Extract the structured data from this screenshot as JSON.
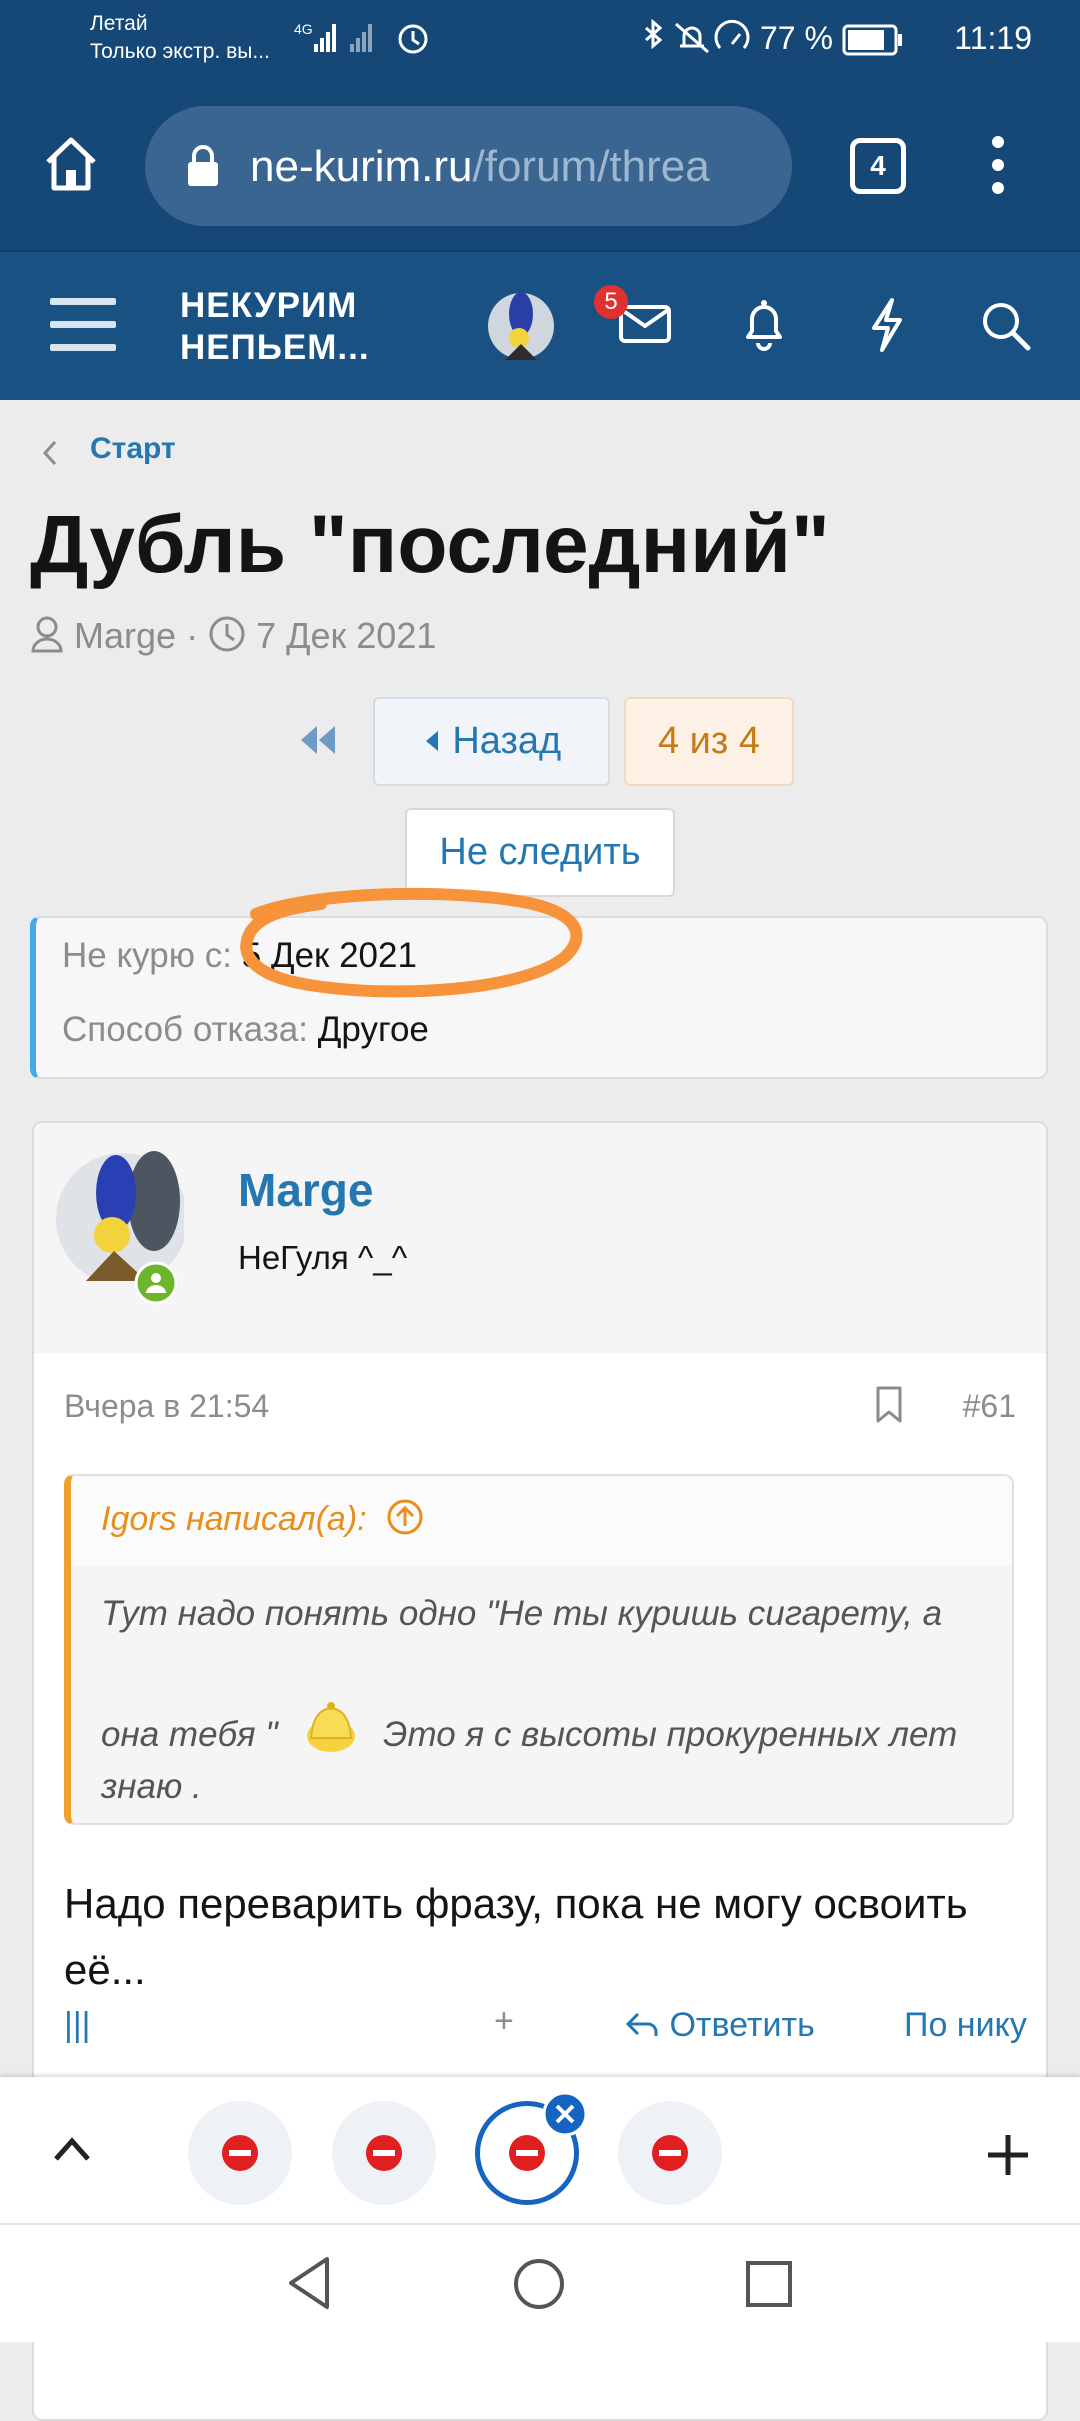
{
  "status_bar": {
    "carrier_line1": "Летай",
    "carrier_line2": "Только экстр. вы...",
    "battery": "77 %",
    "time": "11:19"
  },
  "browser": {
    "url_domain": "ne-kurim.ru",
    "url_path": "/forum/threa",
    "tab_count": "4"
  },
  "site_header": {
    "logo_line1": "НЕКУРИМ",
    "logo_line2": "НЕПЬЕМ...",
    "messages_badge": "5"
  },
  "breadcrumb": "Старт",
  "thread": {
    "title": "Дубль \"последний\"",
    "author": "Marge",
    "separator": "·",
    "date": "7 Дек 2021"
  },
  "pagination": {
    "back_label": "Назад",
    "page_label": "4 из 4"
  },
  "unwatch_label": "Не следить",
  "info": {
    "quit_label": "Не курю с:",
    "quit_value": "5 Дек 2021",
    "method_label": "Способ отказа:",
    "method_value": "Другое"
  },
  "post": {
    "username": "Marge",
    "user_title": "НеГуля ^_^",
    "date": "Вчера в 21:54",
    "number": "#61",
    "quote_author": "Igors написал(а):",
    "quote_line1": "Тут надо понять одно \"Не ты куришь сигарету, а",
    "quote_line2": "она тебя \"",
    "quote_line3": "Это я с высоты прокуренных лет",
    "quote_line4": "знаю .",
    "body": "Надо переварить фразу, пока не могу освоить её...",
    "action_reply": "Ответить",
    "action_more": "По нику"
  },
  "colors": {
    "header_bg": "#1a5183",
    "link": "#2577b1",
    "quote_accent": "#f0a02c",
    "info_accent": "#47a7eb",
    "highlight_marker": "#f7933a"
  }
}
